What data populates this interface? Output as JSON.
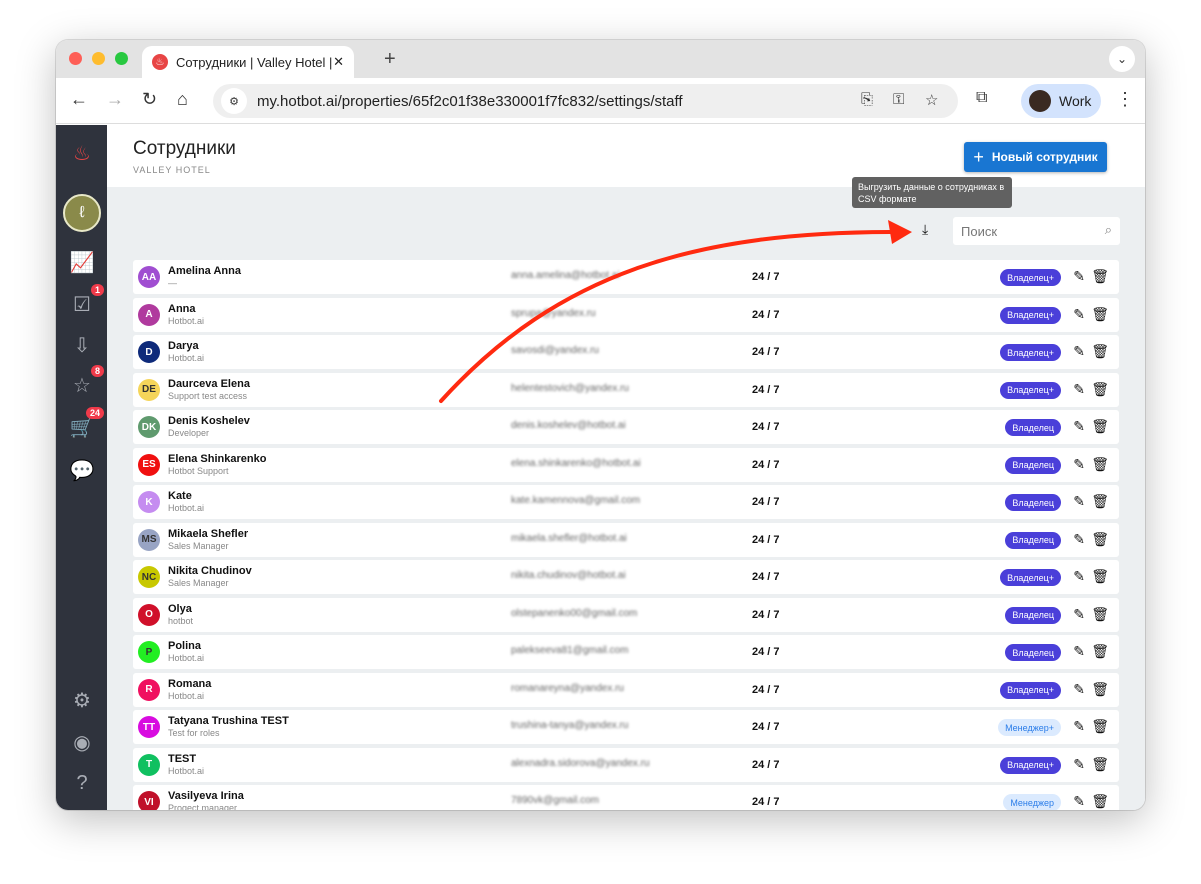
{
  "browser": {
    "tab_title": "Сотрудники | Valley Hotel | H",
    "url": "my.hotbot.ai/properties/65f2c01f38e330001f7fc832/settings/staff",
    "profile_label": "Work"
  },
  "sidebar": {
    "badges": {
      "tasks": "1",
      "reviews": "8",
      "orders": "24"
    }
  },
  "header": {
    "title": "Сотрудники",
    "subtitle": "VALLEY HOTEL",
    "new_button": "Новый сотрудник"
  },
  "toolbar": {
    "tooltip": "Выгрузить данные о сотрудниках в CSV формате",
    "search_placeholder": "Поиск"
  },
  "colors": {
    "owner": "#4a3fd9",
    "manager_bg": "#dbeafe",
    "primary": "#1976d2",
    "sidebar": "#2f333d",
    "arrow": "#ff2a10"
  },
  "staff": [
    {
      "initials": "AA",
      "color": "#a04ed1",
      "name": "Amelina Anna",
      "role": "—",
      "email": "anna.amelina@hotbot.ai",
      "schedule": "24 / 7",
      "access": "Владелец+",
      "type": "owner"
    },
    {
      "initials": "A",
      "color": "#b03a9e",
      "name": "Anna",
      "role": "Hotbot.ai",
      "email": "sprupa@yandex.ru",
      "schedule": "24 / 7",
      "access": "Владелец+",
      "type": "owner"
    },
    {
      "initials": "D",
      "color": "#0e2a7a",
      "name": "Darya",
      "role": "Hotbot.ai",
      "email": "savosdi@yandex.ru",
      "schedule": "24 / 7",
      "access": "Владелец+",
      "type": "owner"
    },
    {
      "initials": "DE",
      "color": "#f5d55a",
      "dark": true,
      "name": "Daurceva Elena",
      "role": "Support test access",
      "email": "helentestovich@yandex.ru",
      "schedule": "24 / 7",
      "access": "Владелец+",
      "type": "owner"
    },
    {
      "initials": "DK",
      "color": "#5f9a6e",
      "name": "Denis Koshelev",
      "role": "Developer",
      "email": "denis.koshelev@hotbot.ai",
      "schedule": "24 / 7",
      "access": "Владелец",
      "type": "owner"
    },
    {
      "initials": "ES",
      "color": "#f01010",
      "name": "Elena Shinkarenko",
      "role": "Hotbot Support",
      "email": "elena.shinkarenko@hotbot.ai",
      "schedule": "24 / 7",
      "access": "Владелец",
      "type": "owner"
    },
    {
      "initials": "K",
      "color": "#c58cf0",
      "name": "Kate",
      "role": "Hotbot.ai",
      "email": "kate.kamennova@gmail.com",
      "schedule": "24 / 7",
      "access": "Владелец",
      "type": "owner"
    },
    {
      "initials": "MS",
      "color": "#98a4c4",
      "dark": true,
      "name": "Mikaela Shefler",
      "role": "Sales Manager",
      "email": "mikaela.shefler@hotbot.ai",
      "schedule": "24 / 7",
      "access": "Владелец",
      "type": "owner"
    },
    {
      "initials": "NC",
      "color": "#c8c800",
      "dark": true,
      "name": "Nikita Chudinov",
      "role": "Sales Manager",
      "email": "nikita.chudinov@hotbot.ai",
      "schedule": "24 / 7",
      "access": "Владелец+",
      "type": "owner"
    },
    {
      "initials": "O",
      "color": "#d0102a",
      "name": "Olya",
      "role": "hotbot",
      "email": "olstepanenko00@gmail.com",
      "schedule": "24 / 7",
      "access": "Владелец",
      "type": "owner"
    },
    {
      "initials": "P",
      "color": "#22ee22",
      "dark": true,
      "name": "Polina",
      "role": "Hotbot.ai",
      "email": "palekseeva81@gmail.com",
      "schedule": "24 / 7",
      "access": "Владелец",
      "type": "owner"
    },
    {
      "initials": "R",
      "color": "#f01060",
      "name": "Romana",
      "role": "Hotbot.ai",
      "email": "romanareyna@yandex.ru",
      "schedule": "24 / 7",
      "access": "Владелец+",
      "type": "owner"
    },
    {
      "initials": "TT",
      "color": "#d80ce0",
      "name": "Tatyana Trushina TEST",
      "role": "Test for roles",
      "email": "trushina-tanya@yandex.ru",
      "schedule": "24 / 7",
      "access": "Менеджер+",
      "type": "manager"
    },
    {
      "initials": "T",
      "color": "#10c060",
      "name": "TEST",
      "role": "Hotbot.ai",
      "email": "alexnadra.sidorova@yandex.ru",
      "schedule": "24 / 7",
      "access": "Владелец+",
      "type": "owner"
    },
    {
      "initials": "VI",
      "color": "#c0102a",
      "name": "Vasilyeva Irina",
      "role": "Progect manager",
      "email": "7890vk@gmail.com",
      "schedule": "24 / 7",
      "access": "Менеджер",
      "type": "manager"
    }
  ]
}
